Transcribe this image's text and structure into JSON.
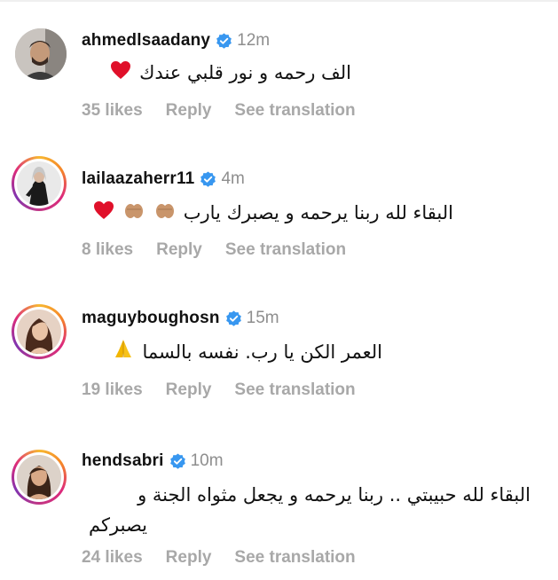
{
  "comments": [
    {
      "username": "ahmedlsaadany",
      "time": "12m",
      "text": "الف رحمه و نور قلبي عندك",
      "emoji": [
        "red-heart-icon"
      ],
      "likes": "35 likes",
      "reply": "Reply",
      "translate": "See translation"
    },
    {
      "username": "lailaazaherr11",
      "time": "4m",
      "text": "البقاء لله ربنا يرحمه و يصبرك يارب",
      "emoji": [
        "praying-hands-icon",
        "praying-hands-icon",
        "red-heart-icon"
      ],
      "likes": "8 likes",
      "reply": "Reply",
      "translate": "See translation"
    },
    {
      "username": "maguyboughosn",
      "time": "15m",
      "text": "العمر الكن يا رب. نفسه بالسما",
      "emoji": [
        "folded-hands-icon"
      ],
      "likes": "19 likes",
      "reply": "Reply",
      "translate": "See translation"
    },
    {
      "username": "hendsabri",
      "time": "10m",
      "text_line1": "البقاء لله حبيبتي .. ربنا يرحمه و يجعل مثواه الجنة و",
      "text_line2": "يصبركم",
      "likes": "24 likes",
      "reply": "Reply",
      "translate": "See translation"
    }
  ],
  "colors": {
    "verified_blue": "#3897f0",
    "muted_text": "#a8a8a8",
    "time_text": "#8e8e8e",
    "heart_red": "#e0102a"
  }
}
